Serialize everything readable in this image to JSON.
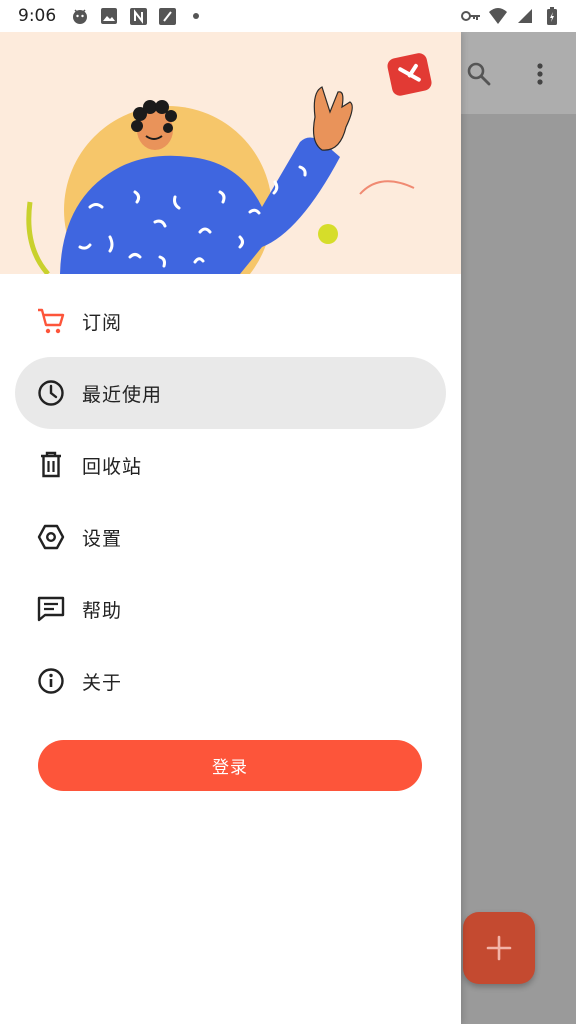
{
  "status_bar": {
    "time": "9:06",
    "left_icons": [
      "android-face-icon",
      "image-icon",
      "notion-icon",
      "edit-note-icon",
      "dot-icon"
    ],
    "right_icons": [
      "vpn-key-icon",
      "wifi-icon",
      "signal-icon",
      "battery-charging-icon"
    ]
  },
  "drawer": {
    "header_illustration": "person-waving-illustration",
    "menu": [
      {
        "label": "订阅",
        "icon": "cart-icon",
        "active": false
      },
      {
        "label": "最近使用",
        "icon": "clock-icon",
        "active": true
      },
      {
        "label": "回收站",
        "icon": "trash-icon",
        "active": false
      },
      {
        "label": "设置",
        "icon": "hexagon-settings-icon",
        "active": false
      },
      {
        "label": "帮助",
        "icon": "message-icon",
        "active": false
      },
      {
        "label": "关于",
        "icon": "info-icon",
        "active": false
      }
    ],
    "login_label": "登录"
  },
  "app_toolbar": {
    "icons": [
      "search-icon",
      "more-vert-icon"
    ]
  },
  "fab": {
    "icon": "plus-icon"
  },
  "colors": {
    "accent": "#fd553a",
    "header_bg": "#fdebdc",
    "active_item_bg": "#e9e9e9",
    "scrim": "#9a9a9a"
  }
}
